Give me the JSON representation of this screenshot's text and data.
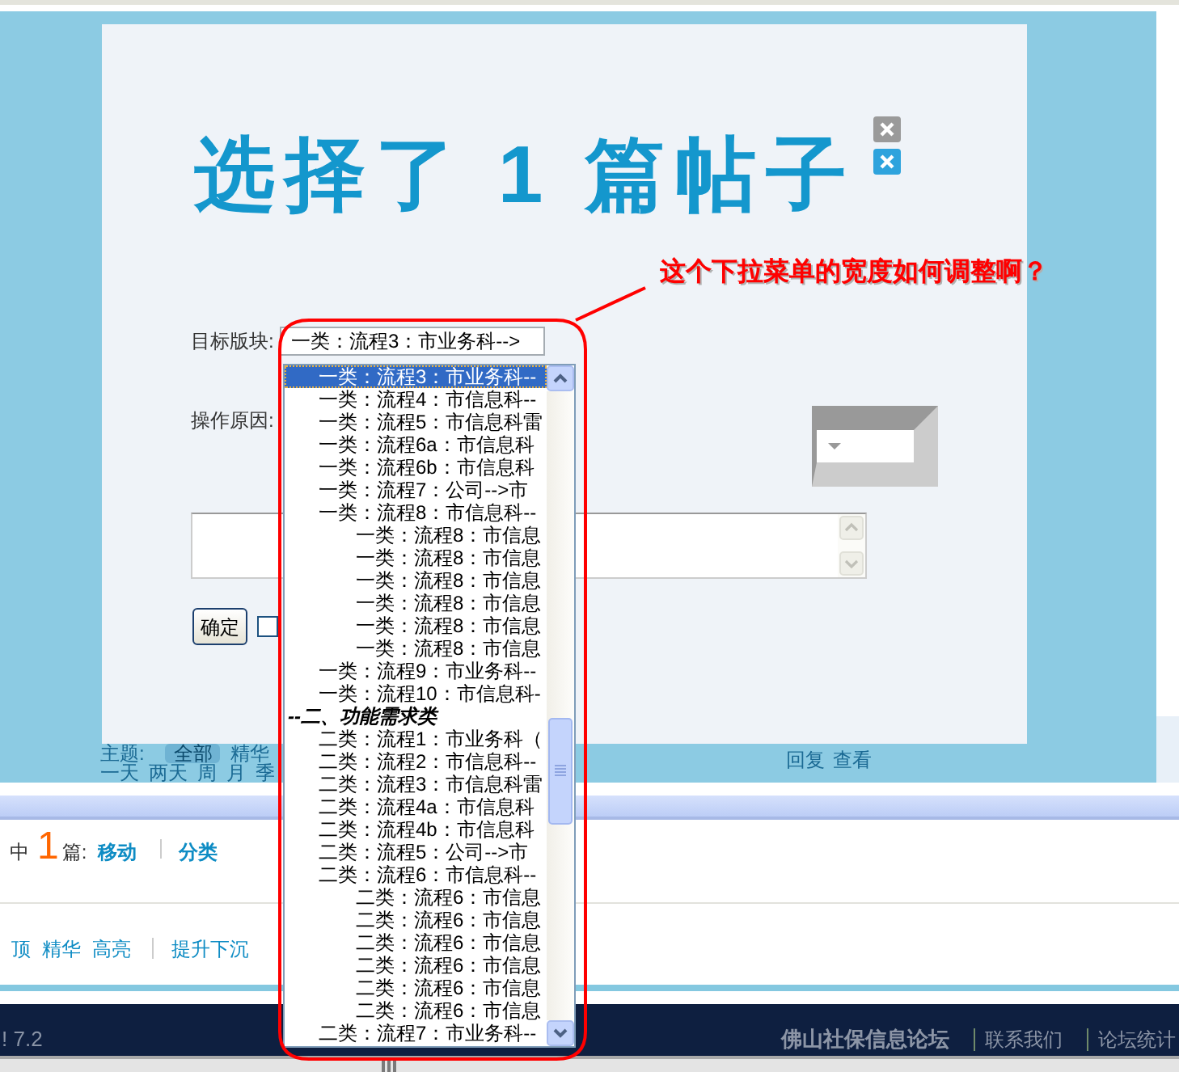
{
  "background": {
    "filters": [
      {
        "label": "主题:",
        "options": [
          {
            "label": "全部",
            "selected": true
          },
          {
            "label": "精华",
            "selected": false
          }
        ]
      },
      {
        "options": [
          {
            "label": "一天",
            "selected": false
          },
          {
            "label": "两天",
            "selected": false
          },
          {
            "label": "周",
            "selected": false
          },
          {
            "label": "月",
            "selected": false
          },
          {
            "label": "季",
            "selected": false
          }
        ]
      }
    ],
    "view_links": [
      "回复",
      "查看"
    ]
  },
  "dialog": {
    "title": "选择了 1 篇帖子",
    "fields": [
      {
        "kind": "select",
        "label": "目标版块:",
        "value": "一类：流程3：市业务科-->"
      },
      {
        "kind": "bevel_select",
        "label": "操作原因:"
      }
    ],
    "confirm_button": "确定",
    "checkbox": {
      "checked": false
    }
  },
  "dropdown": {
    "options": [
      {
        "kind": "option",
        "label": "一类：流程3：市业务科--",
        "selected": true
      },
      {
        "kind": "option",
        "label": "一类：流程4：市信息科--",
        "selected": false
      },
      {
        "kind": "option",
        "label": "一类：流程5：市信息科雷",
        "selected": false
      },
      {
        "kind": "option",
        "label": "一类：流程6a：市信息科",
        "selected": false
      },
      {
        "kind": "option",
        "label": "一类：流程6b：市信息科",
        "selected": false
      },
      {
        "kind": "option",
        "label": "一类：流程7：公司-->市",
        "selected": false
      },
      {
        "kind": "option",
        "label": "一类：流程8：市信息科--",
        "selected": false,
        "children": [
          {
            "kind": "option",
            "label": "一类：流程8：市信息",
            "selected": false
          },
          {
            "kind": "option",
            "label": "一类：流程8：市信息",
            "selected": false
          },
          {
            "kind": "option",
            "label": "一类：流程8：市信息",
            "selected": false
          },
          {
            "kind": "option",
            "label": "一类：流程8：市信息",
            "selected": false
          },
          {
            "kind": "option",
            "label": "一类：流程8：市信息",
            "selected": false
          },
          {
            "kind": "option",
            "label": "一类：流程8：市信息",
            "selected": false
          }
        ]
      },
      {
        "kind": "option",
        "label": "一类：流程9：市业务科--",
        "selected": false
      },
      {
        "kind": "option",
        "label": "一类：流程10：市信息科-",
        "selected": false
      },
      {
        "kind": "group",
        "label": "--二、功能需求类",
        "selected": false
      },
      {
        "kind": "option",
        "label": "二类：流程1：市业务科（",
        "selected": false
      },
      {
        "kind": "option",
        "label": "二类：流程2：市信息科--",
        "selected": false
      },
      {
        "kind": "option",
        "label": "二类：流程3：市信息科雷",
        "selected": false
      },
      {
        "kind": "option",
        "label": "二类：流程4a：市信息科",
        "selected": false
      },
      {
        "kind": "option",
        "label": "二类：流程4b：市信息科",
        "selected": false
      },
      {
        "kind": "option",
        "label": "二类：流程5：公司-->市",
        "selected": false
      },
      {
        "kind": "option",
        "label": "二类：流程6：市信息科--",
        "selected": false,
        "children": [
          {
            "kind": "option",
            "label": "二类：流程6：市信息",
            "selected": false
          },
          {
            "kind": "option",
            "label": "二类：流程6：市信息",
            "selected": false
          },
          {
            "kind": "option",
            "label": "二类：流程6：市信息",
            "selected": false
          },
          {
            "kind": "option",
            "label": "二类：流程6：市信息",
            "selected": false
          },
          {
            "kind": "option",
            "label": "二类：流程6：市信息",
            "selected": false
          },
          {
            "kind": "option",
            "label": "二类：流程6：市信息",
            "selected": false
          }
        ]
      },
      {
        "kind": "option",
        "label": "二类：流程7：市业务科--",
        "selected": false
      }
    ]
  },
  "annotation": {
    "text": "这个下拉菜单的宽度如何调整啊？"
  },
  "selection_bar": {
    "prefix": "中",
    "count": "1",
    "suffix": "篇:",
    "actions": [
      "移动",
      "分类"
    ]
  },
  "moderation_bar": {
    "groups": [
      [
        "顶",
        "精华",
        "高亮"
      ],
      [
        "提升下沉"
      ]
    ]
  },
  "footer": {
    "version": "! 7.2",
    "site_name": "佛山社保信息论坛",
    "links": [
      "联系我们",
      "论坛统计"
    ]
  }
}
